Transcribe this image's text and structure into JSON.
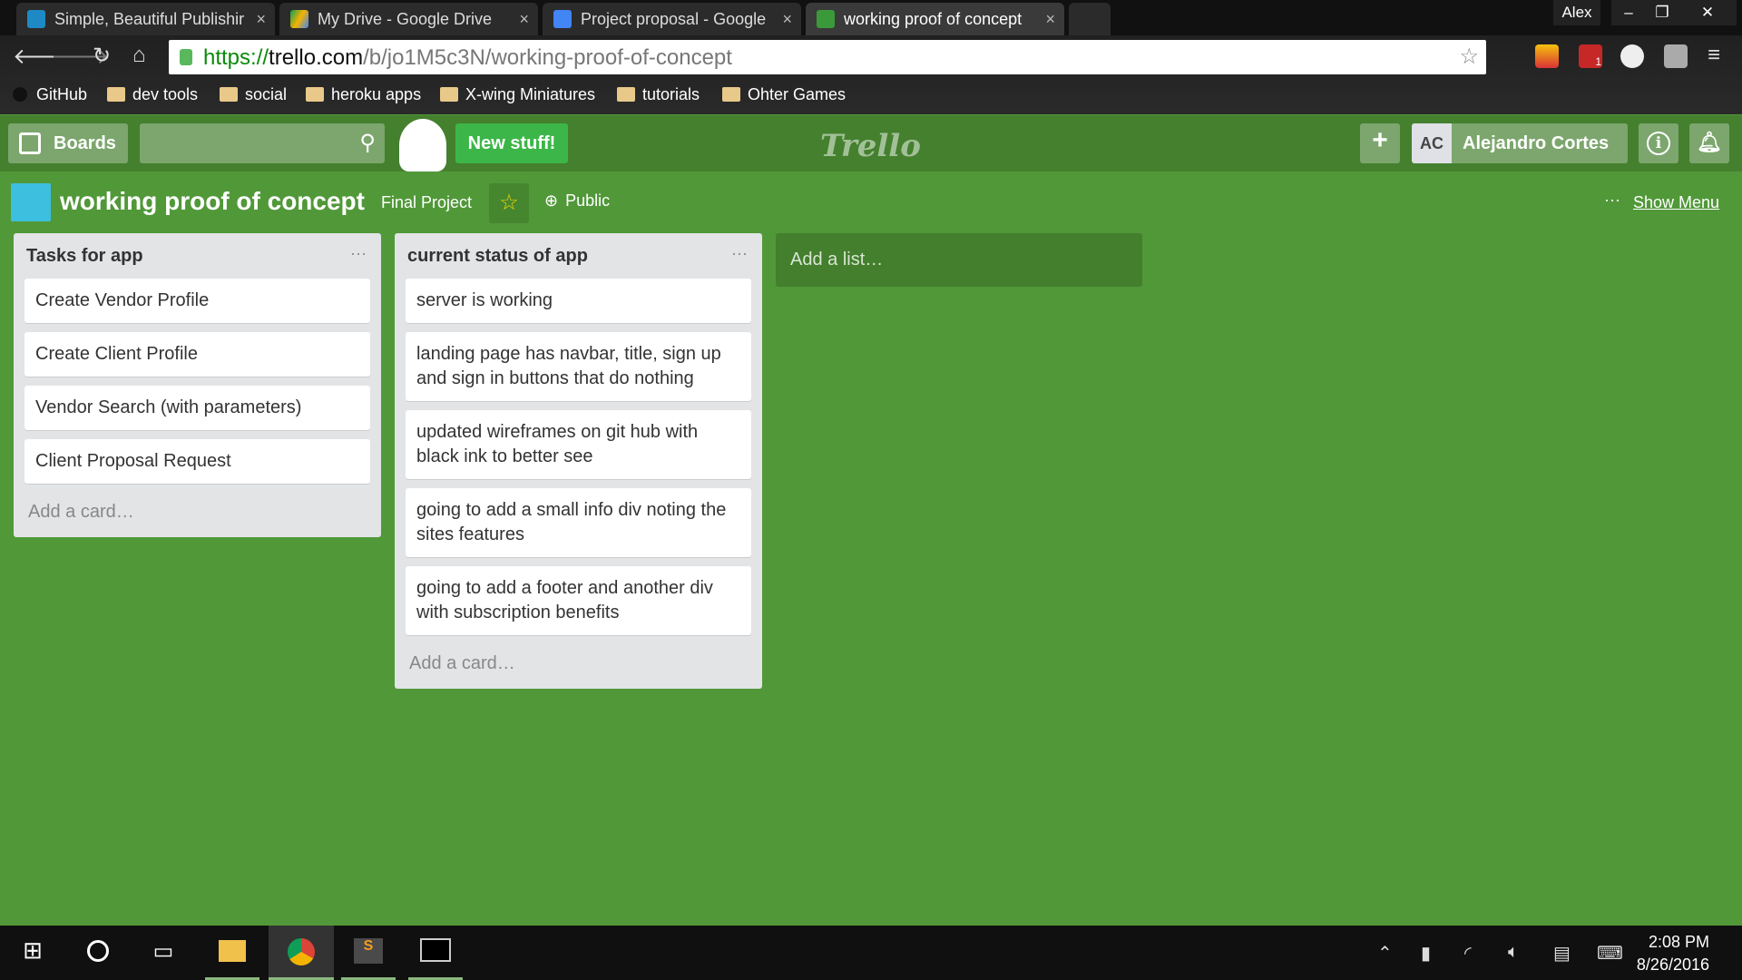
{
  "browser": {
    "tabs": [
      {
        "title": "Simple, Beautiful Publishir",
        "color": "#1e8ac5"
      },
      {
        "title": "My Drive - Google Drive",
        "color": "#f4b400"
      },
      {
        "title": "Project proposal - Google",
        "color": "#4285f4"
      },
      {
        "title": "working proof of concept",
        "color": "#3a9a3a",
        "active": true
      }
    ],
    "user": "Alex",
    "url_scheme": "https://",
    "url_host": "trello.com",
    "url_path": "/b/jo1M5c3N/working-proof-of-concept",
    "gmail_badge": "1",
    "bookmarks": [
      "GitHub",
      "dev tools",
      "social",
      "heroku apps",
      "X-wing Miniatures",
      "tutorials",
      "Ohter Games"
    ]
  },
  "topbar": {
    "boards": "Boards",
    "new_stuff": "New stuff!",
    "logo": "Trello",
    "add": "+",
    "initials": "AC",
    "user_name": "Alejandro Cortes",
    "info": "i"
  },
  "board": {
    "title": "working proof of concept",
    "team": "Final Project",
    "visibility": "Public",
    "show_menu": "Show Menu",
    "more": "···"
  },
  "lists": [
    {
      "title": "Tasks for app",
      "cards": [
        "Create Vendor Profile",
        "Create Client Profile",
        "Vendor Search (with parameters)",
        "Client Proposal Request"
      ],
      "add_card": "Add a card…"
    },
    {
      "title": "current status of app",
      "cards": [
        "server is working",
        "landing page has navbar, title, sign up and sign in buttons that do nothing",
        "updated wireframes on git hub with black ink to better see",
        "going to add a small info div noting the sites features",
        "going to add a footer and another div with subscription benefits"
      ],
      "add_card": "Add a card…"
    }
  ],
  "add_list": "Add a list…",
  "taskbar": {
    "time": "2:08 PM",
    "date": "8/26/2016"
  }
}
